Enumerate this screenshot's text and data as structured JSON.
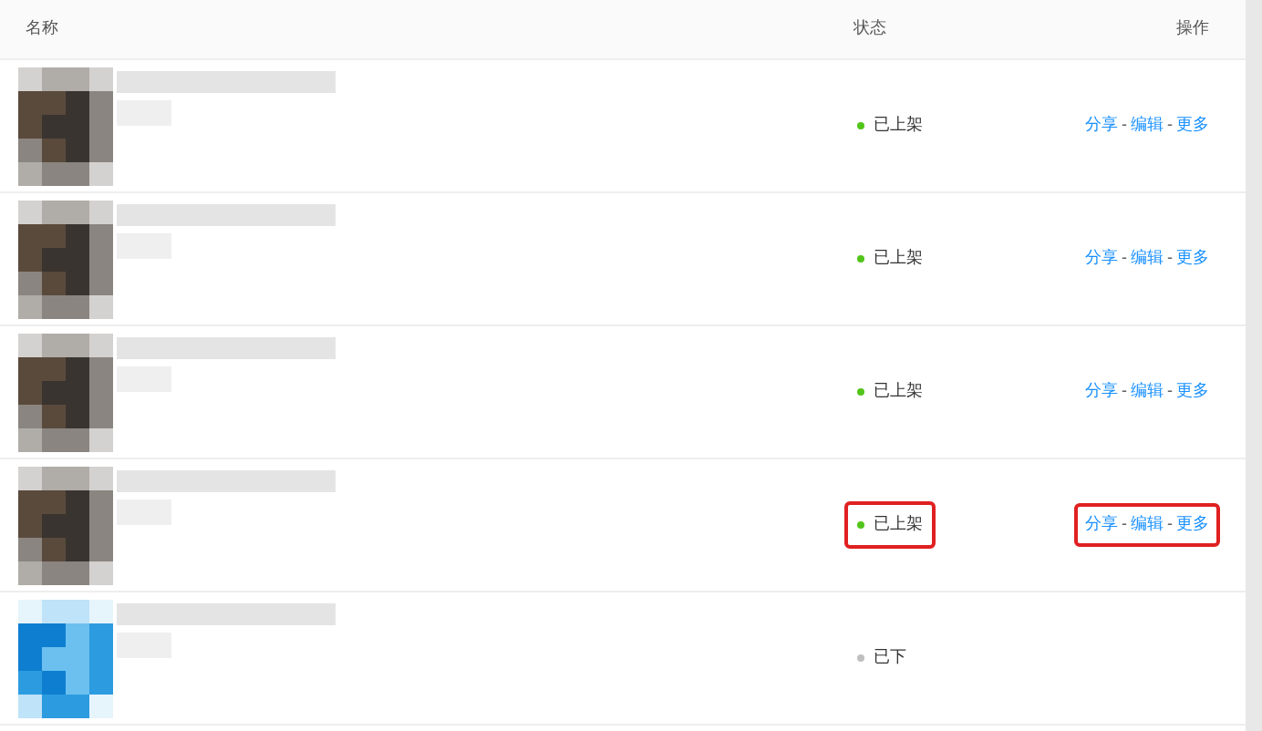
{
  "table": {
    "columns": [
      "名称",
      "状态",
      "操作"
    ],
    "rows": [
      {
        "status": "已上架",
        "color": "#52c41a",
        "actions": [
          "分享",
          "编辑",
          "更多"
        ],
        "separator": "-",
        "highlighted": false
      },
      {
        "status": "已上架",
        "color": "#52c41a",
        "actions": [
          "分享",
          "编辑",
          "更多"
        ],
        "separator": "-",
        "highlighted": false
      },
      {
        "status": "已上架",
        "color": "#52c41a",
        "actions": [
          "分享",
          "编辑",
          "更多"
        ],
        "separator": "-",
        "highlighted": false
      },
      {
        "status": "已上架",
        "color": "#52c41a",
        "actions": [
          "分享",
          "编辑",
          "更多"
        ],
        "separator": "-",
        "highlighted": true
      },
      {
        "status": "已下",
        "color": "#bfbfbf",
        "highlighted": false
      }
    ]
  }
}
